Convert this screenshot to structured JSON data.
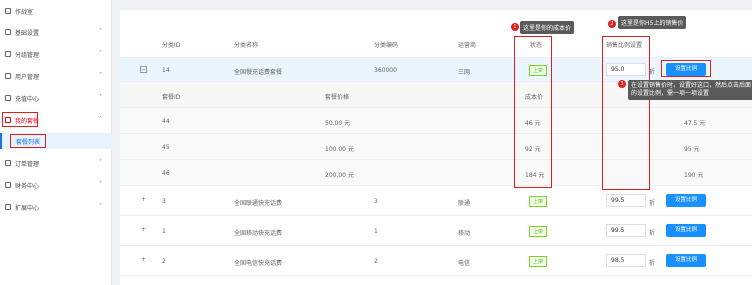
{
  "sidebar": {
    "items": [
      {
        "label": "作战室",
        "icon": "home-icon"
      },
      {
        "label": "基础设置",
        "icon": "gear-icon",
        "chevron": "˅"
      },
      {
        "label": "分组管理",
        "icon": "branch-icon",
        "chevron": "˅"
      },
      {
        "label": "用户管理",
        "icon": "user-icon",
        "chevron": "˅"
      },
      {
        "label": "充值中心",
        "icon": "wallet-icon",
        "chevron": "˅"
      },
      {
        "label": "我的套餐",
        "icon": "package-icon",
        "chevron": "˄"
      },
      {
        "label": "订单管理",
        "icon": "list-icon",
        "chevron": "˅"
      },
      {
        "label": "财务中心",
        "icon": "finance-icon",
        "chevron": "˅"
      },
      {
        "label": "扩展中心",
        "icon": "grid-icon",
        "chevron": "˅"
      }
    ],
    "sub_item": "套餐列表"
  },
  "table": {
    "headers": {
      "id": "分类ID",
      "name": "分类名称",
      "code": "分类编码",
      "operator": "运营商",
      "status": "状态",
      "ratio": "销售比例设置"
    },
    "expanded": {
      "id": "14",
      "name": "全国慢充话费套餐",
      "code": "360000",
      "operator": "三网",
      "status": "上架",
      "ratio": "95.0",
      "unit": "折",
      "button": "设置比例",
      "toggle": "−"
    },
    "sub_headers": {
      "id": "套餐ID",
      "price": "套餐价格",
      "cost": "成本价"
    },
    "sub_rows": [
      {
        "id": "44",
        "price": "50.00 元",
        "cost": "46 元",
        "sale": "47.5 元"
      },
      {
        "id": "45",
        "price": "100.00 元",
        "cost": "92 元",
        "sale": "95 元"
      },
      {
        "id": "46",
        "price": "200.00 元",
        "cost": "184 元",
        "sale": "190 元"
      }
    ],
    "rows": [
      {
        "id": "3",
        "name": "全国联通快充话费",
        "code": "3",
        "operator": "联通",
        "status": "上架",
        "ratio": "99.5",
        "unit": "折",
        "button": "设置比例",
        "toggle": "+"
      },
      {
        "id": "1",
        "name": "全国移动快充话费",
        "code": "1",
        "operator": "移动",
        "status": "上架",
        "ratio": "99.5",
        "unit": "折",
        "button": "设置比例",
        "toggle": "+"
      },
      {
        "id": "2",
        "name": "全国电信快充话费",
        "code": "2",
        "operator": "电信",
        "status": "上架",
        "ratio": "98.5",
        "unit": "折",
        "button": "设置比例",
        "toggle": "+"
      }
    ]
  },
  "annotations": [
    {
      "num": "1",
      "text": "这里是你的成本价"
    },
    {
      "num": "2",
      "text": "这里是你H5上的销售价"
    },
    {
      "num": "3",
      "text": "在设置销售价时，设置好这口，然后点击后面的设置比例，需一项一项设置"
    }
  ],
  "colors": {
    "accent": "#1890ff",
    "highlight": "#e02020",
    "tag_green": "#52c41a"
  }
}
